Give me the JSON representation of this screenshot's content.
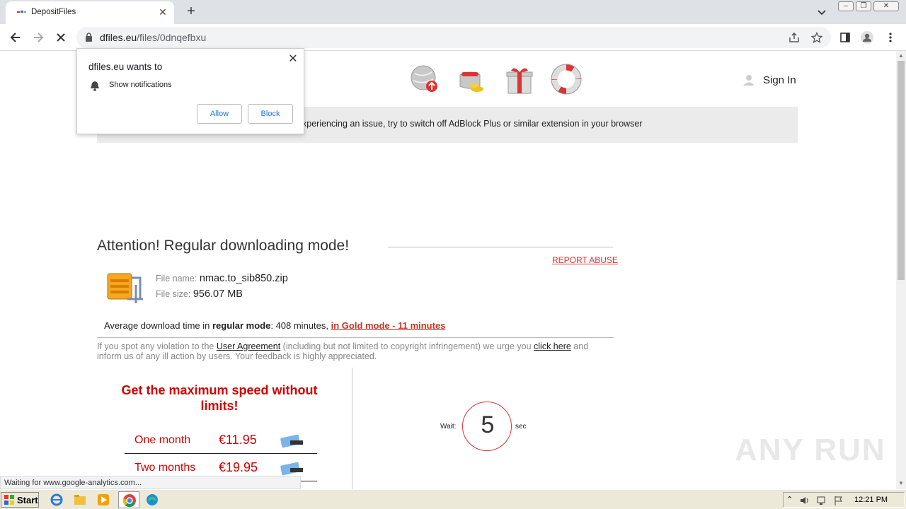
{
  "browser": {
    "tab_title": "DepositFiles",
    "url_domain": "dfiles.eu",
    "url_path": "/files/0dnqefbxu",
    "new_tab_symbol": "+",
    "close_symbol": "✕"
  },
  "header": {
    "icons": [
      "globe-upload-icon",
      "coin-purse-icon",
      "gift-icon",
      "lifebuoy-icon"
    ],
    "sign_in_label": "Sign In"
  },
  "adblock_notice": "xperiencing an issue, try to switch off AdBlock Plus or similar extension in your browser",
  "download": {
    "title": "Attention! Regular downloading mode!",
    "report_abuse": "REPORT ABUSE",
    "file_name_label": "File name:",
    "file_name": "nmac.to_sib850.zip",
    "file_size_label": "File size:",
    "file_size": "956.07 MB",
    "avg_prefix": "Average download time in ",
    "avg_mode": "regular mode",
    "avg_value": ": 408 minutes, ",
    "gold_link": "in Gold mode - 11 minutes"
  },
  "violation": {
    "part1": "If you spot any violation to the ",
    "agreement_link": "User Agreement",
    "part2": " (including but not limited to copyright infringement) we urge you ",
    "click_here": "click here",
    "part3": " and inform us of any ill action by users. Your feedback is highly appreciated."
  },
  "promo": {
    "headline": "Get the maximum speed without limits!",
    "plans": [
      {
        "name": "One month",
        "price": "€11.95"
      },
      {
        "name": "Two months",
        "price": "€19.95"
      }
    ]
  },
  "timer": {
    "wait_label": "Wait:",
    "seconds": "5",
    "sec_label": "sec"
  },
  "popup": {
    "title": "dfiles.eu wants to",
    "permission": "Show notifications",
    "allow": "Allow",
    "block": "Block"
  },
  "status_text": "Waiting for www.google-analytics.com...",
  "watermark": "ANY RUN",
  "taskbar": {
    "start_label": "Start",
    "clock": "12:21 PM"
  },
  "colors": {
    "accent_red": "#d40000",
    "link_red": "#cc3322",
    "chrome_blue": "#1a73e8"
  }
}
